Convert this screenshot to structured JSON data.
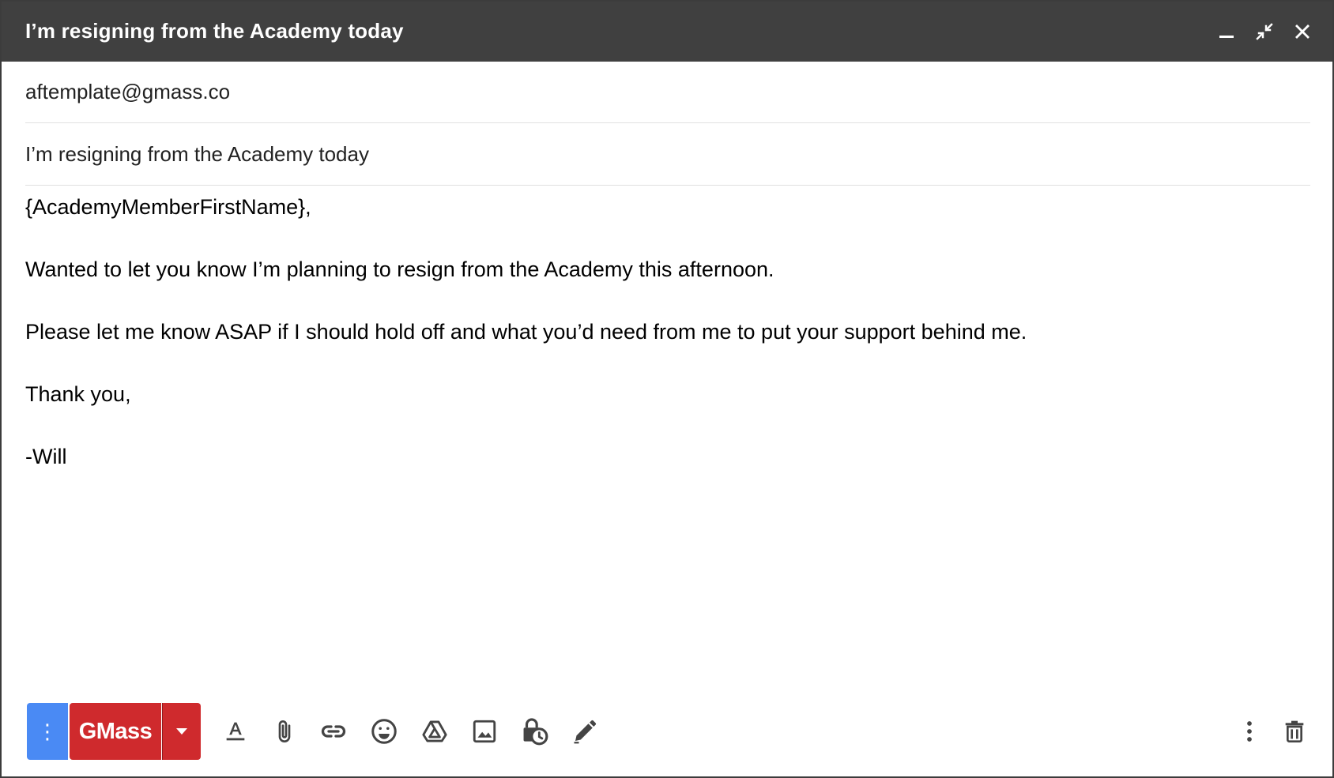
{
  "window": {
    "title": "I’m resigning from the Academy today"
  },
  "to": {
    "value": "aftemplate@gmass.co"
  },
  "subject": {
    "value": "I’m resigning from the Academy today"
  },
  "message": {
    "lines": [
      "{AcademyMemberFirstName},",
      "Wanted to let you know I’m planning to resign from the Academy this afternoon.",
      "Please let me know ASAP if I should hold off and what you’d need from me to put your support behind me.",
      "Thank you,",
      "-Will"
    ]
  },
  "toolbar": {
    "more_options_glyph": "⋮",
    "gmass_label": "GMass",
    "icons": [
      "formatting-icon",
      "attach-icon",
      "link-icon",
      "emoji-icon",
      "drive-icon",
      "photo-icon",
      "confidential-mode-icon",
      "signature-icon",
      "more-options-icon",
      "delete-icon"
    ]
  },
  "colors": {
    "titlebar": "#404040",
    "gmass_red": "#cf2a2d",
    "options_blue": "#4a8af4",
    "icon_gray": "#444444"
  }
}
